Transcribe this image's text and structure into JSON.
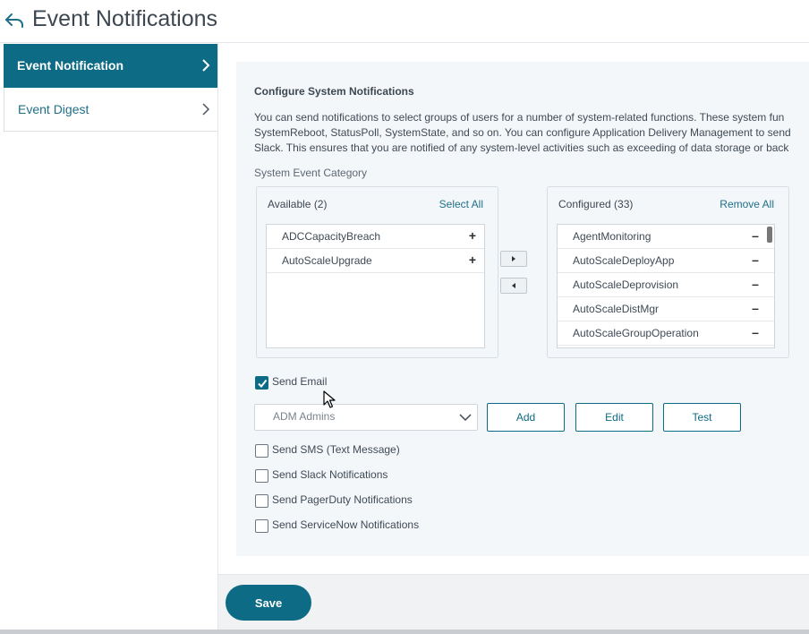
{
  "header": {
    "title": "Event Notifications",
    "back_icon": "back-arrow-icon"
  },
  "sidebar": {
    "items": [
      {
        "label": "Event Notification",
        "active": true
      },
      {
        "label": "Event Digest",
        "active": false
      }
    ]
  },
  "main": {
    "section_title": "Configure System Notifications",
    "description_lines": [
      "You can send notifications to select groups of users for a number of system-related functions. These system fun",
      "SystemReboot, StatusPoll, SystemState, and so on. You can configure Application Delivery Management to send",
      "Slack. This ensures that you are notified of any system-level activities such as exceeding of data storage or back"
    ],
    "category_label": "System Event Category",
    "available": {
      "header": "Available (2)",
      "action": "Select All",
      "items": [
        "ADCCapacityBreach",
        "AutoScaleUpgrade"
      ],
      "item_button": "+"
    },
    "configured": {
      "header": "Configured (33)",
      "action": "Remove All",
      "items": [
        "AgentMonitoring",
        "AutoScaleDeployApp",
        "AutoScaleDeprovision",
        "AutoScaleDistMgr",
        "AutoScaleGroupOperation"
      ],
      "item_button": "–"
    },
    "send_email": {
      "label": "Send Email",
      "checked": true
    },
    "recipient_select": {
      "value": "ADM Admins"
    },
    "buttons": {
      "add": "Add",
      "edit": "Edit",
      "test": "Test"
    },
    "options": [
      {
        "label": "Send SMS (Text Message)",
        "checked": false
      },
      {
        "label": "Send Slack Notifications",
        "checked": false
      },
      {
        "label": "Send PagerDuty Notifications",
        "checked": false
      },
      {
        "label": "Send ServiceNow Notifications",
        "checked": false
      }
    ]
  },
  "footer": {
    "save_label": "Save"
  },
  "colors": {
    "accent": "#0e6b85",
    "panel_bg": "#f4f7fa",
    "link": "#1f6f88"
  }
}
